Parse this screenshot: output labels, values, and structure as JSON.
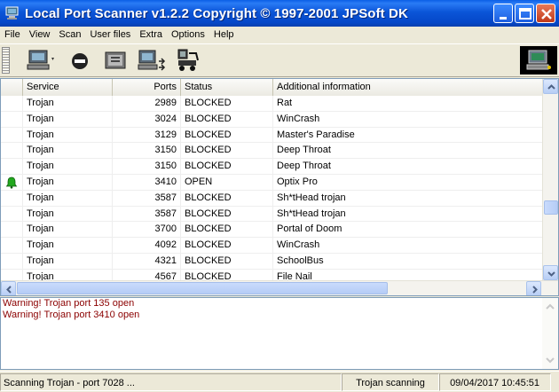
{
  "window": {
    "title": "Local Port Scanner v1.2.2 Copyright © 1997-2001 JPSoft DK"
  },
  "menu": [
    "File",
    "View",
    "Scan",
    "User files",
    "Extra",
    "Options",
    "Help"
  ],
  "toolbar": {
    "buttons": [
      "scan-computer-icon",
      "stop-icon",
      "user-file-icon",
      "port-list-icon",
      "trojan-icon"
    ]
  },
  "list": {
    "headers": [
      "",
      "Service",
      "Ports",
      "Status",
      "Additional information"
    ],
    "rows": [
      {
        "icon": "",
        "service": "Trojan",
        "port": "2989",
        "status": "BLOCKED",
        "info": "Rat"
      },
      {
        "icon": "",
        "service": "Trojan",
        "port": "3024",
        "status": "BLOCKED",
        "info": "WinCrash"
      },
      {
        "icon": "",
        "service": "Trojan",
        "port": "3129",
        "status": "BLOCKED",
        "info": "Master's Paradise"
      },
      {
        "icon": "",
        "service": "Trojan",
        "port": "3150",
        "status": "BLOCKED",
        "info": "Deep Throat"
      },
      {
        "icon": "",
        "service": "Trojan",
        "port": "3150",
        "status": "BLOCKED",
        "info": "Deep Throat"
      },
      {
        "icon": "bell-icon",
        "service": "Trojan",
        "port": "3410",
        "status": "OPEN",
        "info": "Optix Pro"
      },
      {
        "icon": "",
        "service": "Trojan",
        "port": "3587",
        "status": "BLOCKED",
        "info": "Sh*tHead trojan"
      },
      {
        "icon": "",
        "service": "Trojan",
        "port": "3587",
        "status": "BLOCKED",
        "info": "Sh*tHead trojan"
      },
      {
        "icon": "",
        "service": "Trojan",
        "port": "3700",
        "status": "BLOCKED",
        "info": "Portal of Doom"
      },
      {
        "icon": "",
        "service": "Trojan",
        "port": "4092",
        "status": "BLOCKED",
        "info": "WinCrash"
      },
      {
        "icon": "",
        "service": "Trojan",
        "port": "4321",
        "status": "BLOCKED",
        "info": "SchoolBus"
      },
      {
        "icon": "",
        "service": "Trojan",
        "port": "4567",
        "status": "BLOCKED",
        "info": "File Nail"
      }
    ]
  },
  "log": {
    "lines": [
      "Warning! Trojan port 135 open",
      "Warning! Trojan port 3410 open"
    ]
  },
  "statusbar": {
    "message": "Scanning Trojan - port 7028 ...",
    "mode": "Trojan scanning",
    "datetime": "09/04/2017 10:45:51"
  },
  "colors": {
    "title_bar": "#0B55D8",
    "log_text": "#8B0000",
    "open_bell": "#22A81E"
  }
}
